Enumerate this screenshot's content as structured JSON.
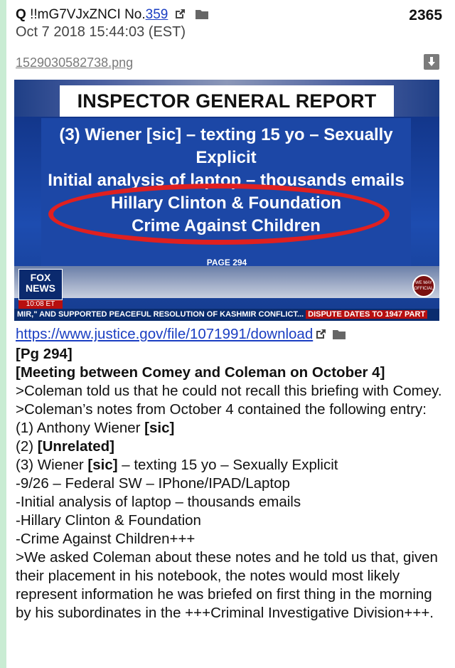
{
  "post": {
    "name": "Q",
    "tripcode": "!!mG7VJxZNCI",
    "number_prefix": "No.",
    "number": "359",
    "date": "Oct 7 2018 15:44:03 (EST)",
    "post_count": "2365"
  },
  "file": {
    "name": "1529030582738.png"
  },
  "image": {
    "banner": "INSPECTOR GENERAL REPORT",
    "lines": [
      "(3) Wiener [sic] – texting 15 yo – Sexually",
      "Explicit",
      "Initial analysis of laptop – thousands emails",
      "Hillary Clinton & Foundation",
      "Crime Against Children"
    ],
    "page_label": "PAGE 294",
    "logo_line1": "FOX",
    "logo_line2": "NEWS",
    "logo_time": "10:08 ET",
    "ticker_left": "MIR,\" AND SUPPORTED PEACEFUL RESOLUTION OF KASHMIR CONFLICT...",
    "ticker_right": "DISPUTE DATES TO 1947 PART",
    "badge": "WE MAY OFFICIAL"
  },
  "body": {
    "link": "https://www.justice.gov/file/1071991/download",
    "lines": {
      "l1": "[Pg 294]",
      "l2": "[Meeting between Comey and Coleman on October 4]",
      "l3": ">Coleman told us that he could not recall this briefing with Comey.",
      "l4": ">Coleman’s notes from October 4 contained the following entry:",
      "l5a": "(1) Anthony Wiener ",
      "l5b": "[sic]",
      "l6a": "(2) ",
      "l6b": "[Unrelated]",
      "l7a": "(3) Wiener ",
      "l7b": "[sic]",
      "l7c": " – texting 15 yo – Sexually Explicit",
      "l8": "-9/26 – Federal SW – IPhone/IPAD/Laptop",
      "l9": "-Initial analysis of laptop – thousands emails",
      "l10": "-Hillary Clinton & Foundation",
      "l11": "-Crime Against Children+++",
      "l12": ">We asked Coleman about these notes and he told us that, given their placement in his notebook, the notes would most likely represent information he was briefed on first thing in the morning by his subordinates in the +++Criminal Investigative Division+++."
    }
  },
  "colors": {
    "accent_bar": "#c9ecd3",
    "link": "#1a3ec2",
    "oval": "#e02020",
    "panel": "#1c47a6"
  }
}
